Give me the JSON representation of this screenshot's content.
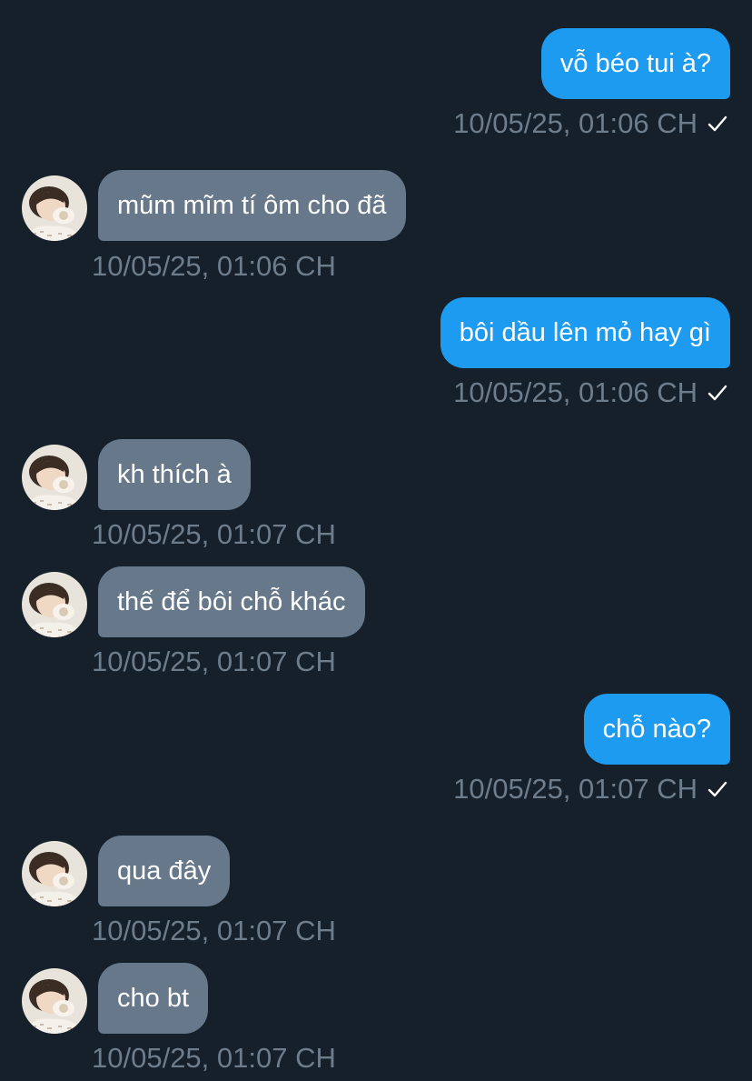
{
  "conversation": {
    "messages": [
      {
        "direction": "sent",
        "text": "vỗ béo tui à?",
        "time": "10/05/25, 01:06 CH",
        "read_icon": "check-icon"
      },
      {
        "direction": "received",
        "text": "mũm mĩm tí ôm cho đã",
        "time": "10/05/25, 01:06 CH"
      },
      {
        "direction": "sent",
        "text": "bôi dầu lên mỏ hay gì",
        "time": "10/05/25, 01:06 CH",
        "read_icon": "check-icon"
      },
      {
        "direction": "received",
        "text": "kh thích à",
        "time": "10/05/25, 01:07 CH"
      },
      {
        "direction": "received",
        "text": "thế để bôi chỗ khác",
        "time": "10/05/25, 01:07 CH"
      },
      {
        "direction": "sent",
        "text": "chỗ nào?",
        "time": "10/05/25, 01:07 CH",
        "read_icon": "check-icon"
      },
      {
        "direction": "received",
        "text": "qua đây",
        "time": "10/05/25, 01:07 CH"
      },
      {
        "direction": "received",
        "text": "cho bt",
        "time": "10/05/25, 01:07 CH"
      }
    ]
  },
  "colors": {
    "background": "#15202b",
    "sent_bubble": "#1d9bf0",
    "received_bubble": "#66788a",
    "timestamp": "#6e7d8b"
  }
}
